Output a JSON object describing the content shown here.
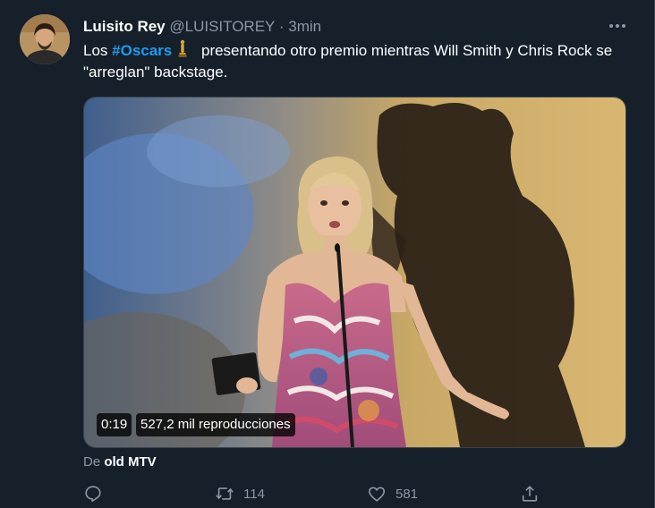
{
  "tweet": {
    "author_name": "Luisito Rey",
    "handle": "@LUISITOREY",
    "separator": "·",
    "time": "3min",
    "text_prefix": "Los ",
    "hashtag": "#Oscars",
    "text_rest": " presentando otro premio mientras Will Smith y Chris Rock se \"arreglan\" backstage."
  },
  "video": {
    "duration": "0:19",
    "views": "527,2 mil reproducciones",
    "source_prefix": "De ",
    "source_name": "old MTV"
  },
  "actions": {
    "reply_count": "",
    "retweet_count": "114",
    "like_count": "581"
  },
  "icons": {
    "more": "more-horizontal-icon",
    "reply": "reply-icon",
    "retweet": "retweet-icon",
    "like": "heart-icon",
    "share": "share-icon",
    "oscar": "oscar-statuette-emoji"
  },
  "colors": {
    "background": "#15202b",
    "accent": "#1d9bf0",
    "secondary_text": "#8b98a5",
    "border": "#38444d"
  }
}
